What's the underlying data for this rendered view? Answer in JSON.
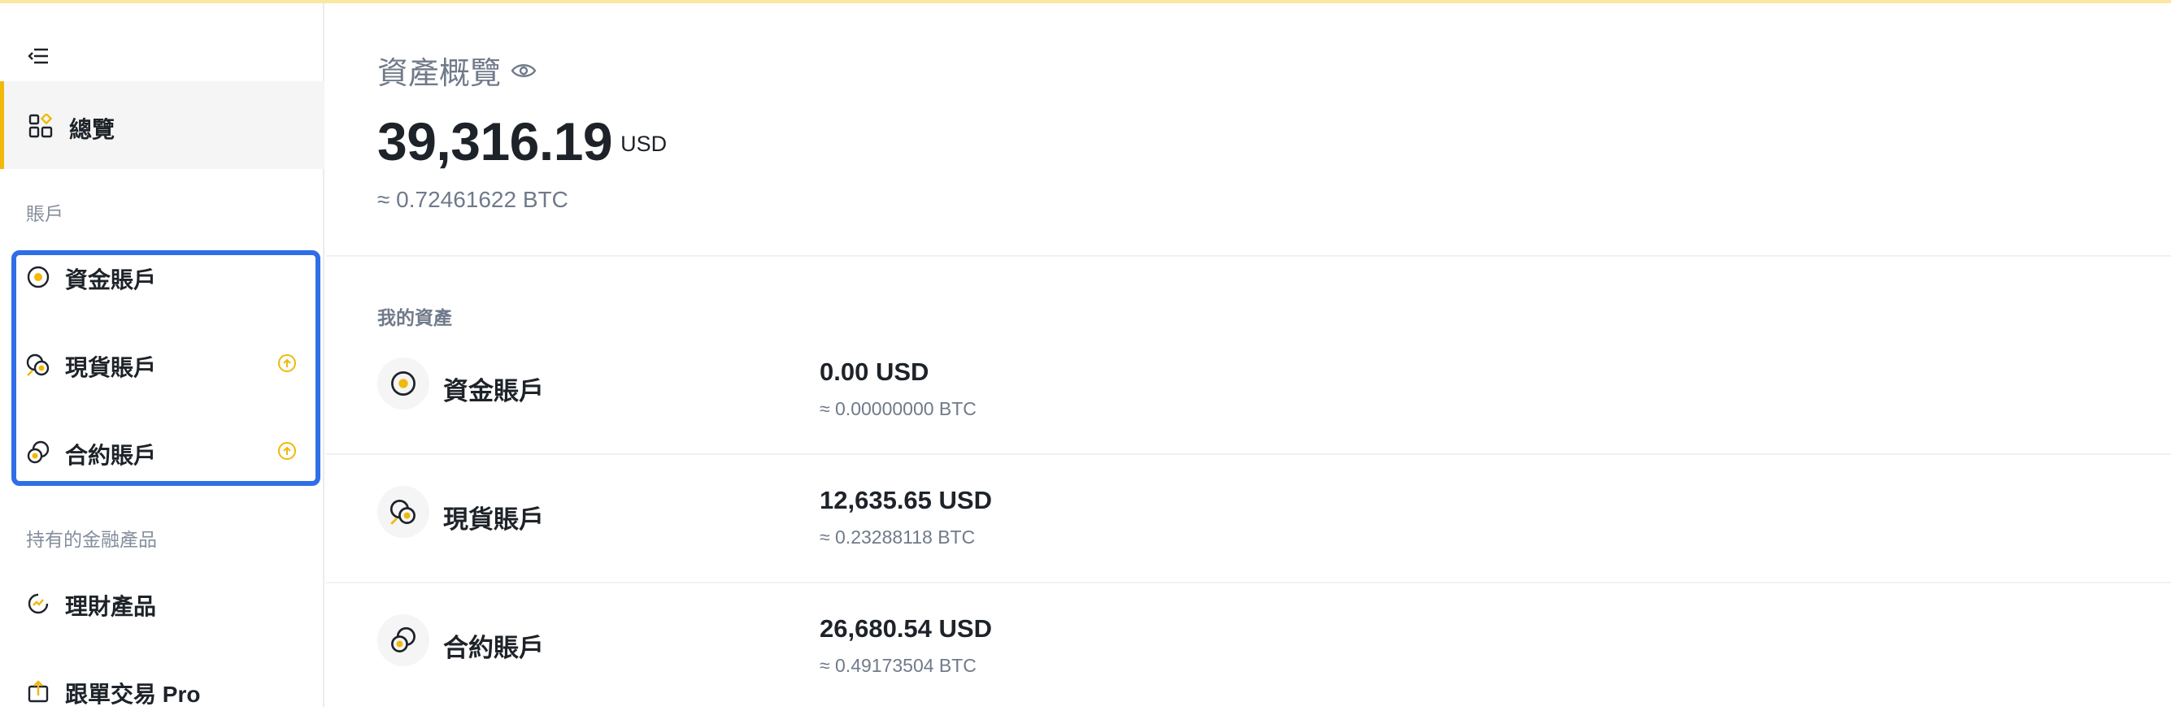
{
  "colors": {
    "accent": "#f0b90b",
    "highlight": "#2f6ee6",
    "muted": "#707a8a",
    "text": "#1e2329"
  },
  "sidebar": {
    "overview_label": "總覽",
    "accounts_title": "賬戶",
    "accounts": [
      {
        "label": "資金賬戶",
        "icon": "funding-icon",
        "badge": null
      },
      {
        "label": "現貨賬戶",
        "icon": "spot-icon",
        "badge": "upgrade-icon"
      },
      {
        "label": "合約賬戶",
        "icon": "futures-icon",
        "badge": "upgrade-icon"
      }
    ],
    "products_title": "持有的金融產品",
    "products": [
      {
        "label": "理財產品",
        "icon": "earn-icon"
      },
      {
        "label": "跟單交易 Pro",
        "icon": "copy-trading-icon"
      }
    ]
  },
  "main": {
    "overview_title": "資產概覽",
    "total_amount": "39,316.19",
    "total_unit": "USD",
    "total_btc": "≈ 0.72461622 BTC",
    "my_assets_title": "我的資產",
    "assets": [
      {
        "name": "資金賬戶",
        "usd": "0.00 USD",
        "btc": "≈ 0.00000000 BTC"
      },
      {
        "name": "現貨賬戶",
        "usd": "12,635.65 USD",
        "btc": "≈ 0.23288118 BTC"
      },
      {
        "name": "合約賬戶",
        "usd": "26,680.54 USD",
        "btc": "≈ 0.49173504 BTC"
      }
    ]
  }
}
